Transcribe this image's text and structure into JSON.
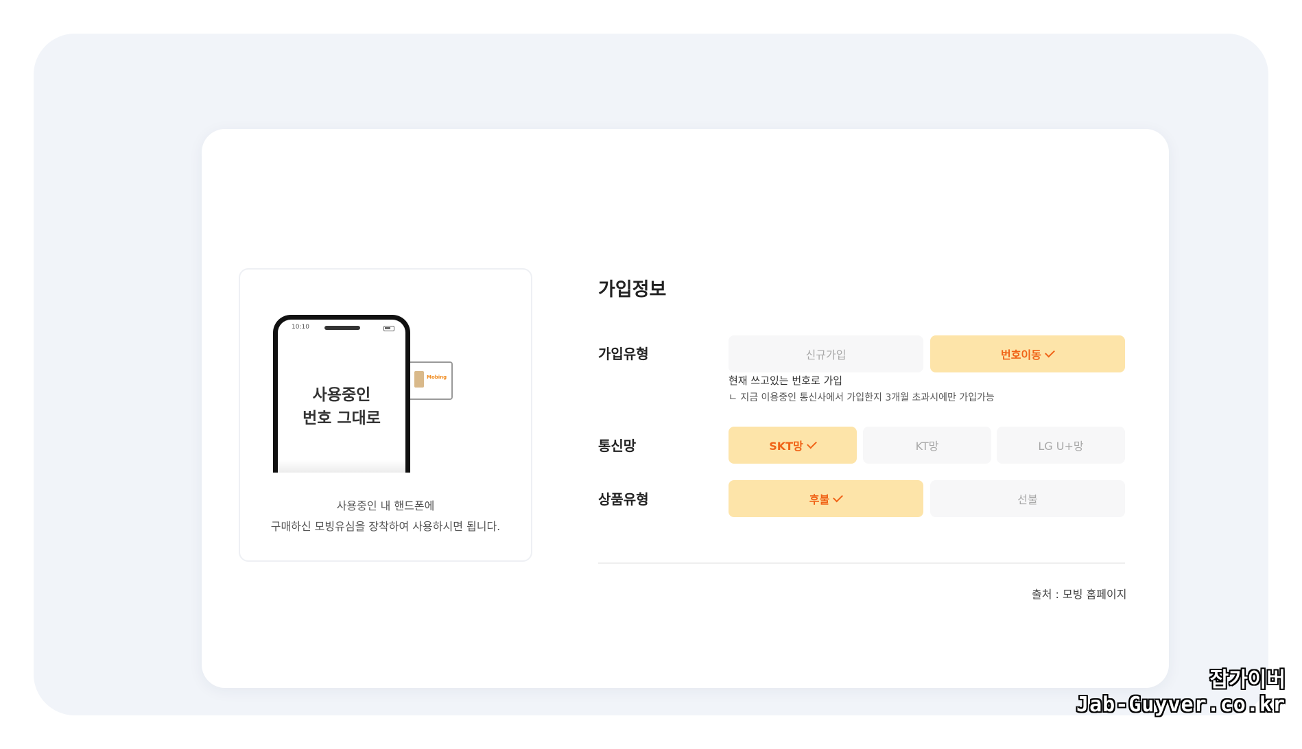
{
  "illustration": {
    "phone_time": "10:10",
    "phone_text_line1": "사용중인",
    "phone_text_line2": "번호 그대로",
    "sim_logo": "Mobing",
    "caption_line1": "사용중인 내 핸드폰에",
    "caption_line2": "구매하신 모빙유심을 장착하여 사용하시면 됩니다."
  },
  "form": {
    "title": "가입정보",
    "join_type": {
      "label": "가입유형",
      "options": [
        {
          "label": "신규가입",
          "selected": false
        },
        {
          "label": "번호이동",
          "selected": true
        }
      ],
      "note_main": "현재 쓰고있는 번호로 가입",
      "note_sub": "ㄴ 지금 이용중인 통신사에서 가입한지 3개월 초과시에만 가입가능"
    },
    "network": {
      "label": "통신망",
      "options": [
        {
          "label": "SKT망",
          "selected": true
        },
        {
          "label": "KT망",
          "selected": false
        },
        {
          "label": "LG U+망",
          "selected": false
        }
      ]
    },
    "product_type": {
      "label": "상품유형",
      "options": [
        {
          "label": "후불",
          "selected": true
        },
        {
          "label": "선불",
          "selected": false
        }
      ]
    }
  },
  "source_text": "출처 : 모빙 홈페이지",
  "watermark": {
    "line1": "잡가이버",
    "line2": "Jab-Guyver.co.kr"
  },
  "colors": {
    "selected_bg": "#fde4a9",
    "selected_text": "#f06317",
    "unselected_bg": "#f7f7f8",
    "outer_bg": "#f1f4f9"
  }
}
